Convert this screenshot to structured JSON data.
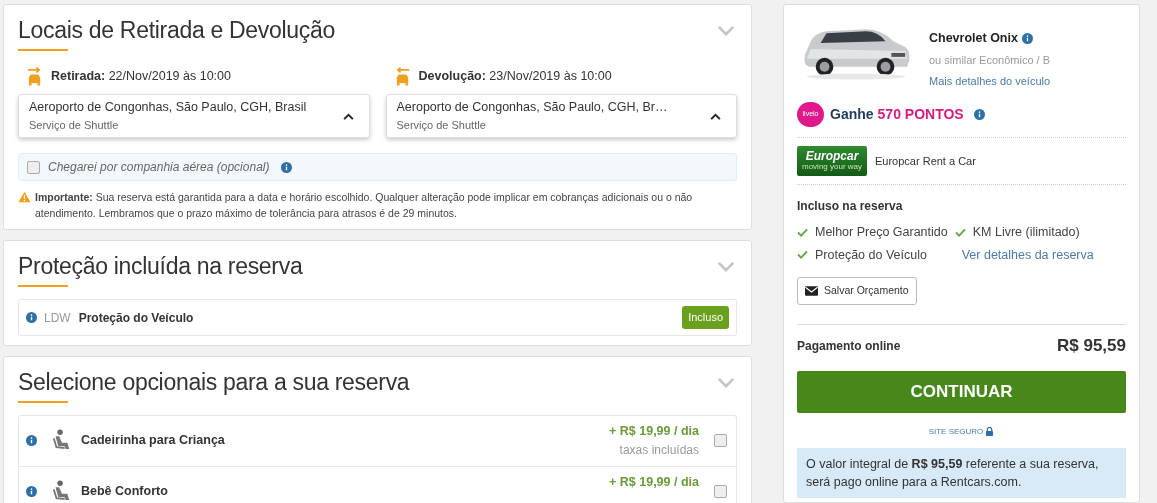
{
  "locations": {
    "title": "Locais de Retirada e Devolução",
    "pickup": {
      "label": "Retirada:",
      "datetime": "22/Nov/2019 às 10:00",
      "place": "Aeroporto de Congonhas, São Paulo, CGH, Brasil",
      "service": "Serviço de Shuttle"
    },
    "dropoff": {
      "label": "Devolução:",
      "datetime": "23/Nov/2019 às 10:00",
      "place": "Aeroporto de Congonhas, São Paulo, CGH, Br…",
      "service": "Serviço de Shuttle"
    },
    "airline": {
      "label": "Chegarei por companhia aérea (opcional)",
      "checked": false
    },
    "notice": "**Importante:** Sua reserva está garantida para a data e horário escolhido. Qualquer alteração pode implicar em cobranças adicionais ou o não atendimento. Lembramos que o prazo máximo de tolerância para atrasos é de 29 minutos."
  },
  "protection": {
    "title": "Proteção incluída na reserva",
    "items": [
      {
        "code": "LDW",
        "name": "Proteção do Veículo",
        "badge": "Incluso"
      }
    ]
  },
  "extras": {
    "title": "Selecione opcionais para a sua reserva",
    "items": [
      {
        "name": "Cadeirinha para Criança",
        "price": "+ R$ 19,99 / dia",
        "note": "taxas incluídas",
        "checked": false
      },
      {
        "name": "Bebê Conforto",
        "price": "+ R$ 19,99 / dia",
        "checked": false
      }
    ]
  },
  "summary": {
    "car": {
      "kind": "picture",
      "name": "Chevrolet Onix",
      "category": "ou similar Econômico / B",
      "details_link": "Mais detalhes do veículo"
    },
    "loyalty": {
      "logo": "livelo",
      "earn": "Ganhe",
      "points": "570 PONTOS"
    },
    "company": {
      "logo_name": "Europcar",
      "logo_tagline": "moving your way",
      "name": "Europcar Rent a Car"
    },
    "included": {
      "title": "Incluso na reserva",
      "items": [
        "Melhor Preço Garantido",
        "KM Livre (ilimitado)",
        "Proteção do Veículo"
      ],
      "link": "Ver detalhes da reserva"
    },
    "save_button": "Salvar Orçamento",
    "payment": {
      "label": "Pagamento online",
      "amount": "R$ 95,59"
    },
    "continue_button": "CONTINUAR",
    "secure": "SITE SEGURO",
    "info": "O valor integral de **R$ 95,59** referente a sua reserva, será pago online para a Rentcars.com."
  }
}
